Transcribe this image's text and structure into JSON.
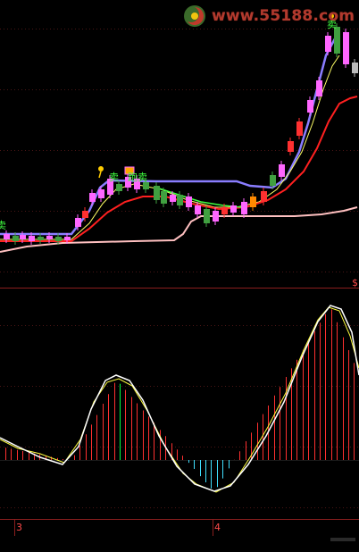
{
  "watermark": {
    "site": "www.55188.com"
  },
  "signals": {
    "left_sell": "卖",
    "mid_sell": "卖",
    "mid_run_sell": "跑卖",
    "top_sell": "卖"
  },
  "bottom_axis": {
    "label_3": "3",
    "label_4": "4"
  },
  "right_marker": "$",
  "colors": {
    "background": "#000000",
    "grid": "#3a1a1a",
    "upper_band": "#8a7dff",
    "middle_line": "#ff2020",
    "yellow_line": "#ffff66",
    "lower_band": "#ffc0c0",
    "oscillator_white": "#ffffff",
    "oscillator_yellow": "#ffff40",
    "histogram_red": "#ff3030",
    "histogram_cyan": "#40e0ff",
    "histogram_green": "#00ff40",
    "histogram_magenta": "#ff66ff"
  }
}
